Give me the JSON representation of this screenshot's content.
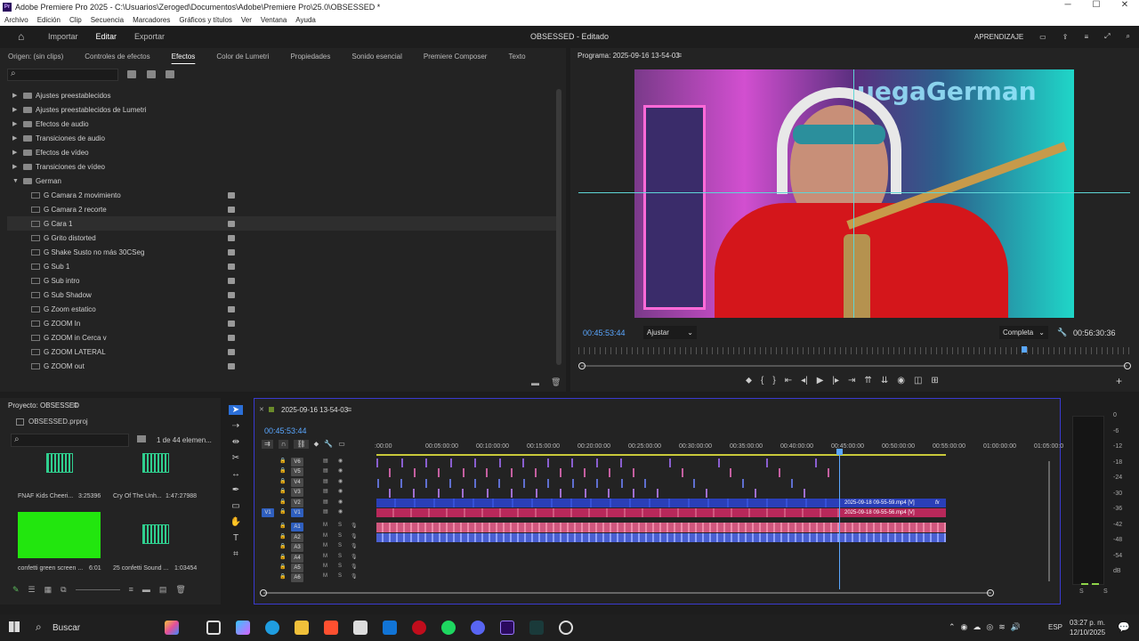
{
  "window": {
    "title": "Adobe Premiere Pro 2025 - C:\\Usuarios\\Zeroged\\Documentos\\Adobe\\Premiere Pro\\25.0\\OBSESSED *"
  },
  "menu": [
    "Archivo",
    "Edición",
    "Clip",
    "Secuencia",
    "Marcadores",
    "Gráficos y títulos",
    "Ver",
    "Ventana",
    "Ayuda"
  ],
  "workspace": {
    "tabs": [
      "Importar",
      "Editar",
      "Exportar"
    ],
    "active": "Editar",
    "center": "OBSESSED - Editado",
    "right_label": "APRENDIZAJE"
  },
  "effects_panel": {
    "tabs": [
      "Origen: (sin clips)",
      "Controles de efectos",
      "Efectos",
      "Color de Lumetri",
      "Propiedades",
      "Sonido esencial",
      "Premiere Composer",
      "Texto"
    ],
    "active_tab": "Efectos",
    "folders": [
      "Ajustes preestablecidos",
      "Ajustes preestablecidos de Lumetri",
      "Efectos de audio",
      "Transiciones de audio",
      "Efectos de vídeo",
      "Transiciones de vídeo",
      "German"
    ],
    "presets": [
      "G Camara 2 movimiento",
      "G Camara 2 recorte",
      "G Cara 1",
      "G Grito distorted",
      "G Shake Susto no más 30CSeg",
      "G Sub 1",
      "G Sub intro",
      "G Sub Shadow",
      "G Zoom estatico",
      "G ZOOM In",
      "G ZOOM in Cerca v",
      "G ZOOM LATERAL",
      "G ZOOM out"
    ],
    "selected_preset": "G Cara 1"
  },
  "program_monitor": {
    "title": "Programa: 2025-09-16 13-54-03",
    "timecode": "00:45:53:44",
    "fit": "Ajustar",
    "quality": "Completa",
    "duration": "00:56:30:36",
    "overlay_text": "uegaGerman"
  },
  "project_panel": {
    "title": "Proyecto: OBSESSED",
    "file": "OBSESSED.prproj",
    "count": "1 de 44 elemen...",
    "items": [
      {
        "name": "FNAF Kids Cheeri...",
        "duration": "3:25396",
        "kind": "audio"
      },
      {
        "name": "Cry Of The Unh...",
        "duration": "1:47:27988",
        "kind": "audio"
      },
      {
        "name": "confetti green screen ...",
        "duration": "6:01",
        "kind": "green"
      },
      {
        "name": "25 confetti Sound ...",
        "duration": "1:03454",
        "kind": "audio"
      }
    ]
  },
  "timeline": {
    "sequence": "2025-09-16 13-54-03",
    "timecode": "00:45:53:44",
    "ruler": [
      ":00:00",
      "00:05:00:00",
      "00:10:00:00",
      "00:15:00:00",
      "00:20:00:00",
      "00:25:00:00",
      "00:30:00:00",
      "00:35:00:00",
      "00:40:00:00",
      "00:45:00:00",
      "00:50:00:00",
      "00:55:00:00",
      "01:00:00:00",
      "01:05:00:00"
    ],
    "video_tracks": [
      "V6",
      "V5",
      "V4",
      "V3",
      "V2",
      "V1"
    ],
    "audio_tracks": [
      "A1",
      "A2",
      "A3",
      "A4",
      "A5",
      "A6"
    ],
    "clip_v2": "2025-09-18 09-55-59.mp4 [V]",
    "clip_v1": "2025-09-18 09-55-56.mp4 [V]",
    "playhead_fraction": 0.684,
    "clip_fx": "fx"
  },
  "meters": {
    "labels": [
      "0",
      "-6",
      "-12",
      "-18",
      "-24",
      "-30",
      "-36",
      "-42",
      "-48",
      "-54",
      "dB"
    ],
    "solo": [
      "S",
      "S"
    ]
  },
  "taskbar": {
    "search": "Buscar",
    "lang": "ESP",
    "time": "03:27 p. m.",
    "date": "12/10/2025"
  },
  "colors": {
    "accent": "#3a3ad0",
    "video_clip": "#2a3fb8",
    "audio_clip": "#d0577e",
    "timecode_blue": "#5aa7ff"
  }
}
